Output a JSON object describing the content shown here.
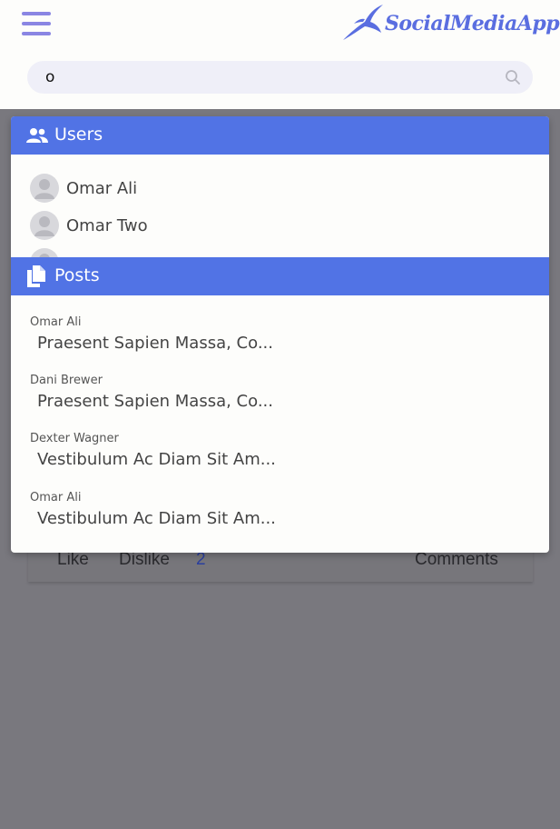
{
  "app": {
    "logo_text": "SocialMediaApp"
  },
  "search": {
    "value": "o",
    "placeholder": ""
  },
  "post_footer": {
    "like_label": "Like",
    "dislike_label": "Dislike",
    "dislike_count": "2",
    "comments_label": "Comments"
  },
  "dropdown": {
    "users": {
      "title": "Users",
      "items": [
        {
          "name": "Omar Ali"
        },
        {
          "name": "Omar Two"
        },
        {
          "name": ""
        }
      ]
    },
    "posts": {
      "title": "Posts",
      "items": [
        {
          "author": "Omar Ali",
          "title": "Praesent Sapien Massa, Co..."
        },
        {
          "author": "Dani Brewer",
          "title": "Praesent Sapien Massa, Co..."
        },
        {
          "author": "Dexter Wagner",
          "title": "Vestibulum Ac Diam Sit Am..."
        },
        {
          "author": "Omar Ali",
          "title": "Vestibulum Ac Diam Sit Am..."
        }
      ]
    }
  },
  "colors": {
    "accent": "#5173e5",
    "hamburger": "#8a86e3",
    "overlay": "#79787e",
    "link_count": "#2b3f9e"
  }
}
